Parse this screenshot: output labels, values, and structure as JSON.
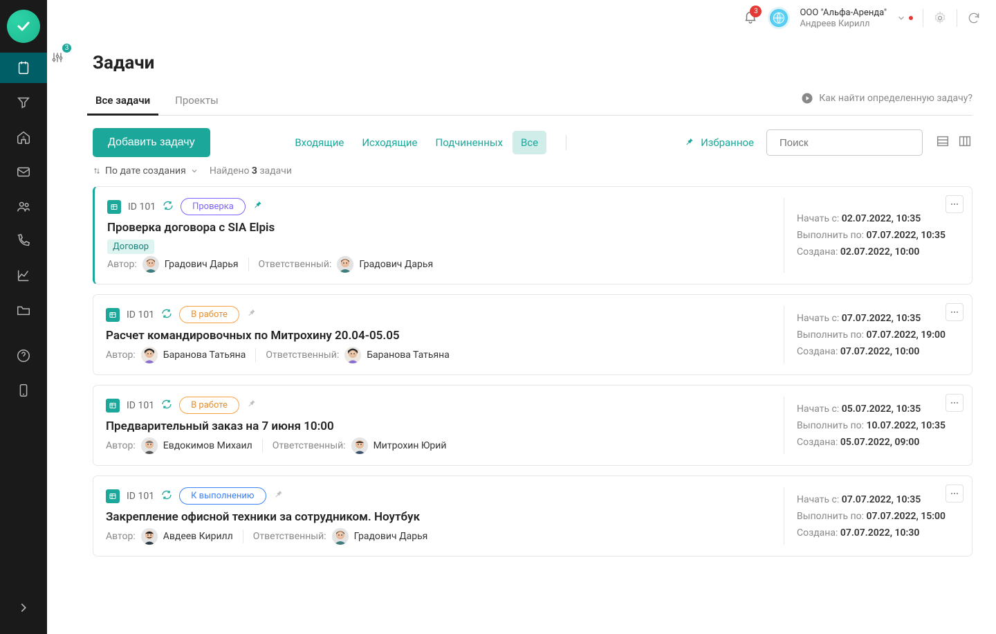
{
  "header": {
    "company": "ООО \"Альфа-Аренда\"",
    "user_name": "Андреев Кирилл",
    "notification_count": "3"
  },
  "second_bar": {
    "badge": "3"
  },
  "page": {
    "title": "Задачи",
    "tabs": {
      "all": "Все задачи",
      "projects": "Проекты"
    },
    "help_link": "Как найти определенную задачу?",
    "add_button": "Добавить задачу",
    "filters": {
      "incoming": "Входящие",
      "outgoing": "Исходящие",
      "subordinates": "Подчиненных",
      "all": "Все",
      "favourites": "Избранное"
    },
    "search_placeholder": "Поиск",
    "sort_label": "По дате создания",
    "found_prefix": "Найдено ",
    "found_count": "3",
    "found_suffix": " задачи"
  },
  "labels": {
    "author": "Автор:",
    "responsible": "Ответственный:",
    "start": "Начать с:",
    "due": "Выполнить по:",
    "created": "Создана:"
  },
  "tasks": [
    {
      "id": "ID 101",
      "status": "Проверка",
      "status_theme": "purple",
      "pinned": true,
      "title": "Проверка договора c SIA Elpis",
      "tag": "Договор",
      "author": "Градович Дарья",
      "responsible": "Градович Дарья",
      "start": "02.07.2022, 10:35",
      "due": "07.07.2022, 10:35",
      "created": "02.07.2022, 10:00",
      "face_a": 1,
      "face_r": 1
    },
    {
      "id": "ID 101",
      "status": "В работе",
      "status_theme": "orange",
      "pinned": false,
      "title": "Расчет командировочных по Митрохину 20.04-05.05",
      "tag": null,
      "author": "Баранова Татьяна",
      "responsible": "Баранова Татьяна",
      "start": "07.07.2022, 10:35",
      "due": "07.07.2022, 19:00",
      "created": "07.07.2022, 10:00",
      "face_a": 2,
      "face_r": 2
    },
    {
      "id": "ID 101",
      "status": "В работе",
      "status_theme": "orange",
      "pinned": false,
      "title": "Предварительный заказ на 7 июня 10:00",
      "tag": null,
      "author": "Евдокимов Михаил",
      "responsible": "Митрохин Юрий",
      "start": "05.07.2022, 10:35",
      "due": "10.07.2022, 10:35",
      "created": "05.07.2022, 09:00",
      "face_a": 3,
      "face_r": 4
    },
    {
      "id": "ID 101",
      "status": "К выполнению",
      "status_theme": "blue",
      "pinned": false,
      "title": "Закрепление офисной техники за сотрудником. Ноутбук",
      "tag": null,
      "author": "Авдеев Кирилл",
      "responsible": "Градович Дарья",
      "start": "07.07.2022, 10:35",
      "due": "07.07.2022, 15:00",
      "created": "07.07.2022, 10:30",
      "face_a": 5,
      "face_r": 1
    }
  ]
}
